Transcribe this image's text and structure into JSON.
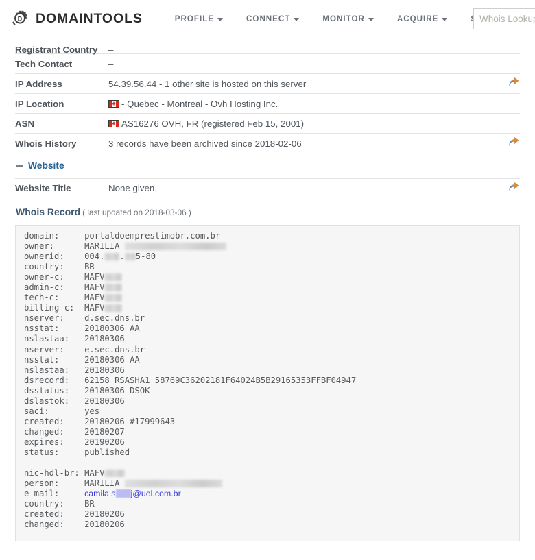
{
  "header": {
    "brand_name": "DOMAINTOOLS",
    "logo_icon": "gear-d-logo-icon",
    "nav": [
      {
        "label": "PROFILE",
        "has_caret": true
      },
      {
        "label": "CONNECT",
        "has_caret": true
      },
      {
        "label": "MONITOR",
        "has_caret": true
      },
      {
        "label": "ACQUIRE",
        "has_caret": true
      },
      {
        "label": "SUPPORT",
        "has_caret": false
      }
    ],
    "search": {
      "placeholder": "Whois Lookup",
      "value": ""
    }
  },
  "profile_rows": [
    {
      "label": "Registrant Country",
      "value": "–",
      "flag": false,
      "share": false,
      "clipped": true
    },
    {
      "label": "Tech Contact",
      "value": "–",
      "flag": false,
      "share": false
    },
    {
      "label": "IP Address",
      "value": "54.39.56.44 - 1 other site is hosted on this server",
      "flag": false,
      "share": true
    },
    {
      "label": "IP Location",
      "value": "- Quebec - Montreal - Ovh Hosting Inc.",
      "flag": true,
      "flag_name": "canada-flag-icon",
      "share": false
    },
    {
      "label": "ASN",
      "value": "AS16276 OVH, FR (registered Feb 15, 2001)",
      "flag": true,
      "flag_name": "canada-flag-icon",
      "share": false
    },
    {
      "label": "Whois History",
      "value": "3 records have been archived since 2018-02-06",
      "flag": false,
      "share": true
    }
  ],
  "website_section": {
    "title": "Website",
    "collapse_icon": "minus-collapse-icon",
    "rows": [
      {
        "label": "Website Title",
        "value": "None given.",
        "share": true
      }
    ]
  },
  "whois_record": {
    "title": "Whois Record",
    "meta": "( last updated on 2018-03-06 )",
    "lines": [
      {
        "key": "domain:",
        "value": "portaldoemprestimobr.com.br"
      },
      {
        "key": "owner:",
        "value": "MARILIA ",
        "redact_w": 148
      },
      {
        "key": "ownerid:",
        "value": "004.",
        "redact_w": 22,
        "value2": ".",
        "redact2_w": 16,
        "value3": "5-80"
      },
      {
        "key": "country:",
        "value": "BR"
      },
      {
        "key": "owner-c:",
        "value": "MAFV",
        "redact_w": 26
      },
      {
        "key": "admin-c:",
        "value": "MAFV",
        "redact_w": 26
      },
      {
        "key": "tech-c:",
        "value": "MAFV",
        "redact_w": 26
      },
      {
        "key": "billing-c:",
        "value": "MAFV",
        "redact_w": 26
      },
      {
        "key": "nserver:",
        "value": "d.sec.dns.br"
      },
      {
        "key": "nsstat:",
        "value": "20180306 AA"
      },
      {
        "key": "nslastaa:",
        "value": "20180306"
      },
      {
        "key": "nserver:",
        "value": "e.sec.dns.br"
      },
      {
        "key": "nsstat:",
        "value": "20180306 AA"
      },
      {
        "key": "nslastaa:",
        "value": "20180306"
      },
      {
        "key": "dsrecord:",
        "value": "62158 RSASHA1 58769C36202181F64024B5B29165353FFBF04947"
      },
      {
        "key": "dsstatus:",
        "value": "20180306 DSOK"
      },
      {
        "key": "dslastok:",
        "value": "20180306"
      },
      {
        "key": "saci:",
        "value": "yes"
      },
      {
        "key": "created:",
        "value": "20180206 #17999643"
      },
      {
        "key": "changed:",
        "value": "20180207"
      },
      {
        "key": "expires:",
        "value": "20190206"
      },
      {
        "key": "status:",
        "value": "published"
      },
      {
        "key": "",
        "value": ""
      },
      {
        "key": "nic-hdl-br:",
        "value": "MAFV",
        "redact_w": 30
      },
      {
        "key": "person:",
        "value": "MARILIA ",
        "redact_w": 142
      },
      {
        "key": "e-mail:",
        "value": "camila.s",
        "redact_w": 22,
        "value3": "j@uol.com.br",
        "email": true
      },
      {
        "key": "country:",
        "value": "BR"
      },
      {
        "key": "created:",
        "value": "20180206"
      },
      {
        "key": "changed:",
        "value": "20180206"
      }
    ]
  }
}
